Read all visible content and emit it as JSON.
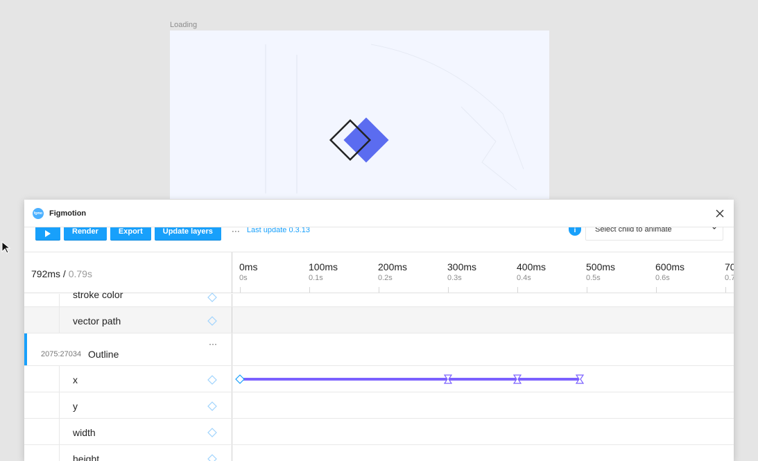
{
  "canvas": {
    "frame_label": "Loading"
  },
  "plugin": {
    "title": "Figmotion",
    "logo_text": "fgmo"
  },
  "toolbar": {
    "play_icon": "play-icon",
    "render_label": "Render",
    "export_label": "Export",
    "update_layers_label": "Update layers",
    "more_label": "···",
    "last_update": "Last update 0.3.13",
    "info_label": "i",
    "child_select_value": "Select child to animate"
  },
  "timeline": {
    "current": "792ms",
    "separator": "/",
    "total": "0.79s",
    "ticks": [
      {
        "ms": "0ms",
        "s": "0s"
      },
      {
        "ms": "100ms",
        "s": "0.1s"
      },
      {
        "ms": "200ms",
        "s": "0.2s"
      },
      {
        "ms": "300ms",
        "s": "0.3s"
      },
      {
        "ms": "400ms",
        "s": "0.4s"
      },
      {
        "ms": "500ms",
        "s": "0.5s"
      },
      {
        "ms": "600ms",
        "s": "0.6s"
      },
      {
        "ms": "70",
        "s": "0.7"
      }
    ]
  },
  "rows": {
    "stroke_color": "stroke color",
    "vector_path": "vector path",
    "layer_id": "2075:27034",
    "layer_name": "Outline",
    "layer_more": "···",
    "x": "x",
    "y": "y",
    "width": "width",
    "height": "height"
  },
  "x_track_keyframes_ms": [
    0,
    300,
    400,
    490
  ],
  "colors": {
    "accent": "#18a0fb",
    "track": "#7b61ff"
  }
}
